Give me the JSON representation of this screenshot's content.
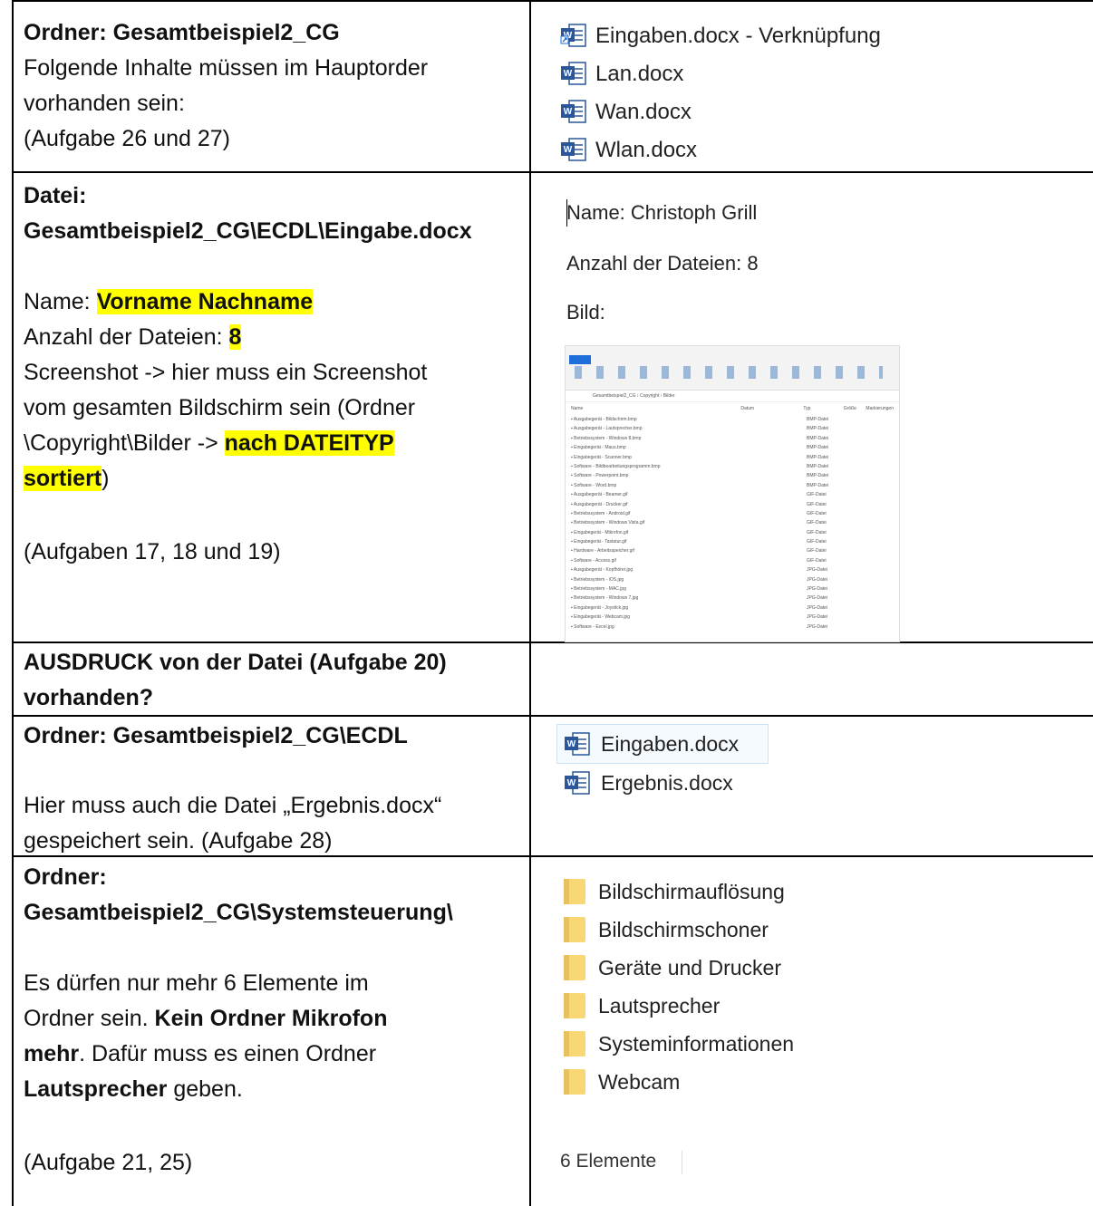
{
  "rows": [
    {
      "left": {
        "heading": "Ordner: Gesamtbeispiel2_CG",
        "lines": [
          "Folgende Inhalte müssen im Hauptorder",
          "vorhanden sein:",
          "(Aufgabe 26 und 27)"
        ]
      },
      "right": {
        "files": [
          "Eingaben.docx - Verknüpfung",
          "Lan.docx",
          "Wan.docx",
          "Wlan.docx"
        ]
      }
    },
    {
      "left": {
        "heading_1": "Datei:",
        "heading_2": "Gesamtbeispiel2_CG\\ECDL\\Eingabe.docx",
        "name_label": "Name: ",
        "name_value": "Vorname Nachname",
        "count_label": "Anzahl der Dateien: ",
        "count_value": "8",
        "screenshot_line_1": "Screenshot -> hier muss ein Screenshot",
        "screenshot_line_2": "vom gesamten Bildschirm sein (Ordner",
        "screenshot_line_3a": "\\Copyright\\Bilder -> ",
        "screenshot_line_3b": "nach DATEITYP",
        "screenshot_line_4a": "sortiert",
        "screenshot_line_4b": ")",
        "tasks": "(Aufgaben 17, 18 und 19)"
      },
      "right": {
        "doc_name": "Name: Christoph Grill",
        "doc_count": "Anzahl der Dateien: 8",
        "doc_bild": "Bild:",
        "explorer": {
          "path": "Gesamtbeispiel2_CG › Copyright › Bilder",
          "columns": [
            "Name",
            "Datum",
            "Typ",
            "Größe",
            "Markierungen"
          ],
          "files": [
            "Ausgabegerät - Bildschirm.bmp",
            "Ausgabegerät - Lautsprecher.bmp",
            "Betriebssystem - Windows 8.bmp",
            "Eingabegerät - Maus.bmp",
            "Eingabegerät - Scanner.bmp",
            "Software - Bildbearbeitungsprogramm.bmp",
            "Software - Powerpoint.bmp",
            "Software - Word.bmp",
            "Ausgabegerät - Beamer.gif",
            "Ausgabegerät - Drucker.gif",
            "Betriebssystem - Android.gif",
            "Betriebssystem - Windows Vista.gif",
            "Eingabegerät - Mikrofon.gif",
            "Eingabegerät - Tastatur.gif",
            "Hardware - Arbeitsspeicher.gif",
            "Software - Access.gif",
            "Ausgabegerät - Kopfhörer.jpg",
            "Betriebssystem - iOS.jpg",
            "Betriebssystem - MAC.jpg",
            "Betriebssystem - Windows 7.jpg",
            "Eingabegerät - Joystick.jpg",
            "Eingabegerät - Webcam.jpg",
            "Software - Excel.jpg"
          ],
          "types": [
            "BMP-Datei",
            "GIF-Datei",
            "JPG-Datei"
          ]
        }
      }
    },
    {
      "left": {
        "line_1": "AUSDRUCK von der Datei (Aufgabe 20)",
        "line_2": "vorhanden?"
      }
    },
    {
      "left": {
        "heading": "Ordner: Gesamtbeispiel2_CG\\ECDL",
        "line_1": "Hier muss auch die Datei „Ergebnis.docx“",
        "line_2": "gespeichert sein. (Aufgabe 28)"
      },
      "right": {
        "files": [
          "Eingaben.docx",
          "Ergebnis.docx"
        ]
      }
    },
    {
      "left": {
        "heading_1": "Ordner:",
        "heading_2": "Gesamtbeispiel2_CG\\Systemsteuerung\\",
        "p1": "Es dürfen nur mehr 6 Elemente im",
        "p2a": "Ordner sein. ",
        "p2b": "Kein Ordner Mikrofon",
        "p3a": "mehr",
        "p3b": ". Dafür muss es einen Ordner",
        "p4a": "Lautsprecher",
        "p4b": " geben.",
        "tasks": "(Aufgabe 21, 25)"
      },
      "right": {
        "folders": [
          "Bildschirmauflösung",
          "Bildschirmschoner",
          "Geräte und Drucker",
          "Lautsprecher",
          "Systeminformationen",
          "Webcam"
        ],
        "count": "6 Elemente"
      }
    }
  ],
  "colors": {
    "highlight": "#ffff00",
    "folder": "#f8d775",
    "word": "#2b579a"
  },
  "icons": [
    "word-shortcut-icon",
    "word-doc-icon",
    "folder-icon"
  ]
}
